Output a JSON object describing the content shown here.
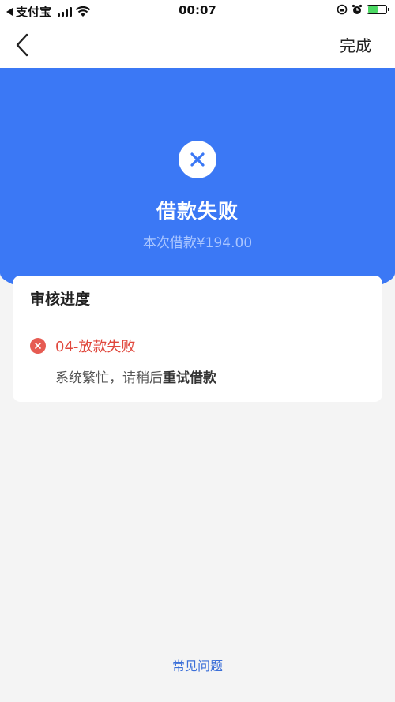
{
  "status_bar": {
    "back_app": "支付宝",
    "time": "00:07",
    "battery_color": "#4cd964",
    "battery_level": 0.55
  },
  "nav": {
    "back_icon": "chevron-left-icon",
    "done_label": "完成"
  },
  "header": {
    "background": "#3b78f5",
    "status_icon": "close-icon",
    "title": "借款失败",
    "subtitle": "本次借款¥194.00"
  },
  "progress": {
    "title": "审核进度",
    "steps": [
      {
        "status_icon": "error-circle-icon",
        "title": "04-放款失败",
        "desc_prefix": "系统繁忙，请稍后",
        "desc_emphasis": "重试借款",
        "color": "#e0473c"
      }
    ]
  },
  "footer": {
    "faq_label": "常见问题",
    "link_color": "#3b6fd8"
  }
}
